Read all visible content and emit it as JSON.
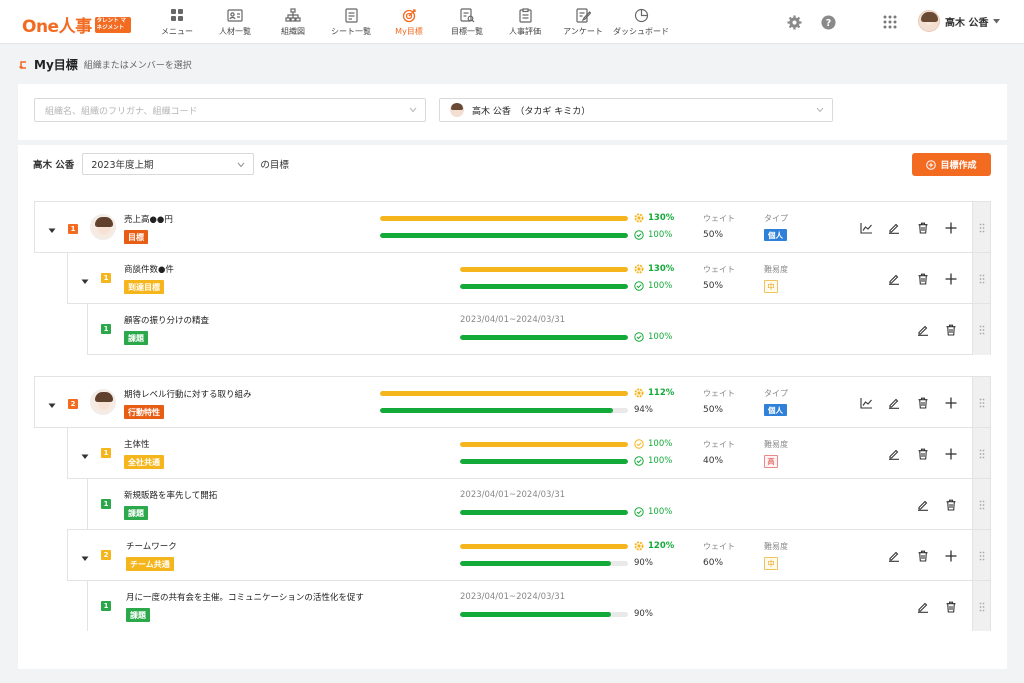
{
  "header": {
    "logo_text": "One人事",
    "logo_badge": "タレント マネジメント",
    "nav": [
      {
        "label": "メニュー",
        "icon": "grid-icon"
      },
      {
        "label": "人材一覧",
        "icon": "id-card-icon"
      },
      {
        "label": "組織図",
        "icon": "org-chart-icon"
      },
      {
        "label": "シート一覧",
        "icon": "sheet-icon"
      },
      {
        "label": "My目標",
        "icon": "target-icon",
        "active": true
      },
      {
        "label": "目標一覧",
        "icon": "goal-list-icon"
      },
      {
        "label": "人事評価",
        "icon": "clipboard-icon"
      },
      {
        "label": "アンケート",
        "icon": "survey-icon"
      },
      {
        "label": "ダッシュボード",
        "icon": "pie-chart-icon"
      }
    ],
    "user_name": "高木 公香"
  },
  "page": {
    "title": "My目標",
    "subtitle": "組織またはメンバーを選択"
  },
  "filters": {
    "org_placeholder": "組織名、組織のフリガナ、組織コード",
    "member_value": "高木 公香　（タカギ キミカ）"
  },
  "period": {
    "owner": "高木 公香",
    "value": "2023年度上期",
    "suffix": "の目標",
    "create_label": "目標作成"
  },
  "groups": [
    {
      "rows": [
        {
          "level": 1,
          "num": "1",
          "name": "売上高●●円",
          "tag": "目標",
          "bar1": 1.0,
          "pct1": "130%",
          "bar2": 1.0,
          "pct2": "100%",
          "weight_label": "ウェイト",
          "weight": "50%",
          "type_label": "タイプ",
          "type": "個人"
        },
        {
          "level": 2,
          "num": "1",
          "name": "商談件数●件",
          "tag": "到達目標",
          "bar1": 1.0,
          "pct1": "130%",
          "bar2": 1.0,
          "pct2": "100%",
          "weight_label": "ウェイト",
          "weight": "50%",
          "diff_label": "難易度",
          "diff": "中"
        },
        {
          "level": 3,
          "num": "1",
          "name": "顧客の振り分けの精査",
          "tag": "課題",
          "period": "2023/04/01~2024/03/31",
          "bar2": 1.0,
          "pct2": "100%"
        }
      ]
    },
    {
      "rows": [
        {
          "level": 1,
          "num": "2",
          "name": "期待レベル行動に対する取り組み",
          "tag": "行動特性",
          "bar1": 1.0,
          "pct1": "112%",
          "bar2": 0.94,
          "pct2": "94%",
          "weight_label": "ウェイト",
          "weight": "50%",
          "type_label": "タイプ",
          "type": "個人"
        },
        {
          "level": 2,
          "num": "1",
          "name": "主体性",
          "tag": "全社共通",
          "bar1": 1.0,
          "pct1": "100%",
          "bar2": 1.0,
          "pct2": "100%",
          "weight_label": "ウェイト",
          "weight": "40%",
          "diff_label": "難易度",
          "diff": "高"
        },
        {
          "level": 3,
          "num": "1",
          "name": "新規販路を率先して開拓",
          "tag": "課題",
          "period": "2023/04/01~2024/03/31",
          "bar2": 1.0,
          "pct2": "100%"
        },
        {
          "level": 2,
          "num": "2",
          "name": "チームワーク",
          "tag": "チーム共通",
          "bar1": 1.0,
          "pct1": "120%",
          "bar2": 0.9,
          "pct2": "90%",
          "weight_label": "ウェイト",
          "weight": "60%",
          "diff_label": "難易度",
          "diff": "中"
        },
        {
          "level": 3,
          "num": "1",
          "name": "月に一度の共有会を主催。コミュニケーションの活性化を促す",
          "tag": "課題",
          "period": "2023/04/01~2024/03/31",
          "bar2": 0.9,
          "pct2": "90%"
        }
      ]
    }
  ],
  "colors": {
    "accent": "#f26b21",
    "progress_yellow": "#f5b51c",
    "progress_green": "#14aa3a",
    "type_blue": "#2f80d8"
  }
}
